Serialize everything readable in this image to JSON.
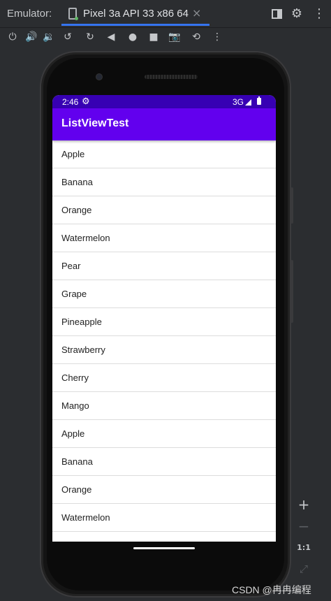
{
  "titlebar": {
    "label": "Emulator:",
    "tab_title": "Pixel 3a API 33 x86 64",
    "tab_close": "×"
  },
  "toolbar": {
    "icons": [
      "power-icon",
      "volume-up-icon",
      "volume-down-icon",
      "rotate-left-icon",
      "rotate-right-icon",
      "back-icon",
      "home-icon",
      "overview-icon",
      "screenshot-icon",
      "snapshot-icon",
      "more-icon"
    ]
  },
  "status_bar": {
    "time": "2:46",
    "network": "3G"
  },
  "app": {
    "title": "ListViewTest",
    "items": [
      "Apple",
      "Banana",
      "Orange",
      "Watermelon",
      "Pear",
      "Grape",
      "Pineapple",
      "Strawberry",
      "Cherry",
      "Mango",
      "Apple",
      "Banana",
      "Orange",
      "Watermelon"
    ]
  },
  "side_panel": {
    "zoom_in": "+",
    "zoom_out": "−",
    "zoom_fit": "1:1"
  },
  "watermark": "CSDN @冉冉编程",
  "colors": {
    "status_bar": "#3700b3",
    "app_bar": "#6200ee",
    "tab_underline": "#3574f0"
  }
}
